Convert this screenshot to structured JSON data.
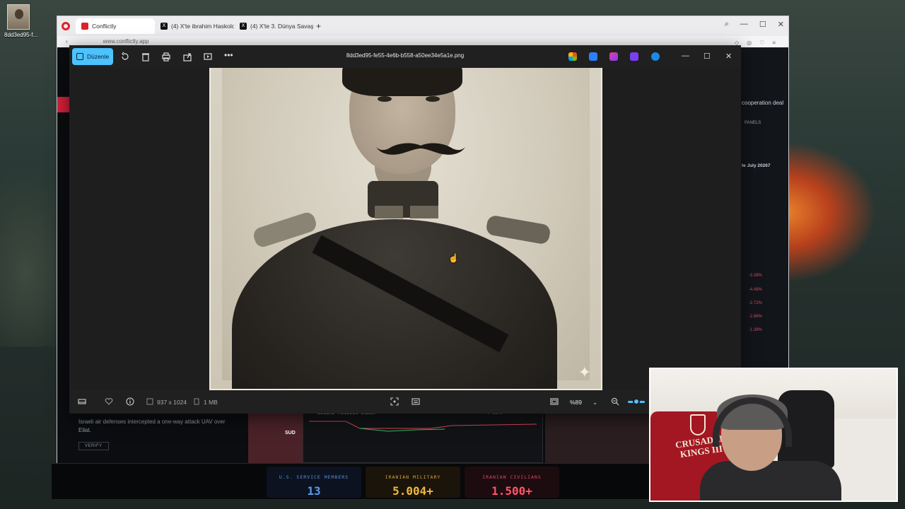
{
  "desktop": {
    "icon_label": "8dd3ed95-f..."
  },
  "browser": {
    "tabs": [
      {
        "label": "Conflictly",
        "favicon": "conflictly-icon"
      },
      {
        "label": "(4) X'te ibrahim Haskoloğ",
        "favicon": "x-icon"
      },
      {
        "label": "(4) X'te 3. Dünya Savaşı",
        "favicon": "x-icon"
      }
    ],
    "url": "www.conflictly.app",
    "site": {
      "right_snippet": "cooperation deal",
      "panels_label": "PANELS",
      "date_label": "te July 20267",
      "feed_text": "Israeli air defenses intercepted a one-way attack UAV over Eilat.",
      "verify_label": "VERIFY",
      "map_label": "SUD",
      "tension_title": "GLOBAL TENSION INDEX",
      "tension_delta": "↓ -28%",
      "changes": [
        "-3.38%",
        "-4.48%",
        "-2.72%",
        "-2.86%",
        "-1.38%"
      ]
    }
  },
  "viewer": {
    "edit_label": "Düzenle",
    "filename": "8dd3ed95-fe55-4e6b-b558-a50ee34e5a1e.png",
    "dimensions": "937 x 1024",
    "filesize": "1 MB",
    "zoom": "%89",
    "zoom_level": 0.5,
    "accent": "#4cc2ff"
  },
  "stats": [
    {
      "label": "U.S. SERVICE MEMBERS",
      "value": "13",
      "label_color": "#5b8fd8",
      "value_color": "#5b9be8",
      "bg": "#0c1220"
    },
    {
      "label": "IRANIAN MILITARY",
      "value": "5.004+",
      "label_color": "#d8a43a",
      "value_color": "#f0b93c",
      "bg": "#1a140a"
    },
    {
      "label": "IRANIAN CIVILIANS",
      "value": "1.500+",
      "label_color": "#e0485a",
      "value_color": "#ff5468",
      "bg": "#1c0c10"
    }
  ],
  "webcam": {
    "chair_text": "CRUSADER KINGS III"
  }
}
